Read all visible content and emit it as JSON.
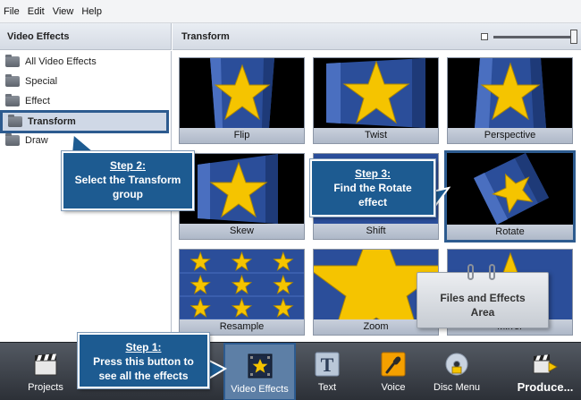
{
  "menubar": {
    "items": [
      "File",
      "Edit",
      "View",
      "Help"
    ]
  },
  "left_panel": {
    "title": "Video Effects",
    "items": [
      {
        "label": "All Video Effects",
        "selected": false
      },
      {
        "label": "Special",
        "selected": false
      },
      {
        "label": "Effect",
        "selected": false
      },
      {
        "label": "Transform",
        "selected": true
      },
      {
        "label": "Draw",
        "selected": false
      }
    ]
  },
  "right_panel": {
    "title": "Transform",
    "tiles": [
      "Flip",
      "Twist",
      "Perspective",
      "Skew",
      "Shift",
      "Rotate",
      "Resample",
      "Zoom",
      "Mirror"
    ]
  },
  "callouts": {
    "step1": {
      "title": "Step 1:",
      "line1": "Press this button to",
      "line2": "see all the effects"
    },
    "step2": {
      "title": "Step 2:",
      "line1": "Select the Transform",
      "line2": "group"
    },
    "step3": {
      "title": "Step 3:",
      "line1": "Find the Rotate",
      "line2": "effect"
    }
  },
  "area_note": {
    "line1": "Files and Effects",
    "line2": "Area"
  },
  "toolbar": {
    "projects": "Projects",
    "video_effects": "Video Effects",
    "text": "Text",
    "voice": "Voice",
    "disc_menu": "Disc Menu",
    "produce": "Produce..."
  },
  "colors": {
    "accent": "#2d5b8f",
    "callout": "#1d5b91",
    "star": "#f5c400",
    "tile_bg": "#2b4e9a"
  }
}
